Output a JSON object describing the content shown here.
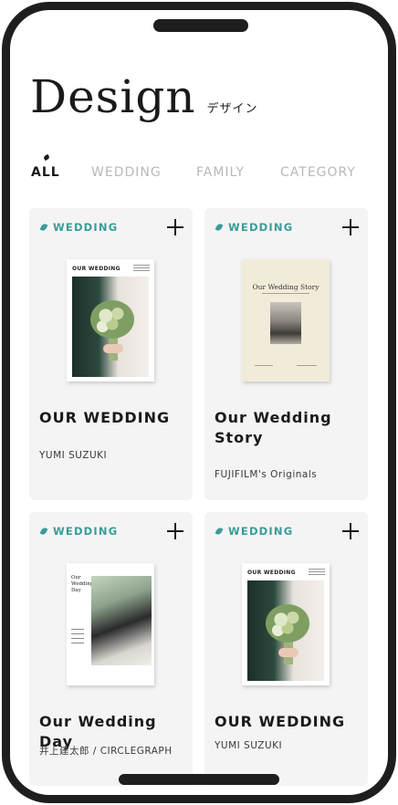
{
  "page": {
    "title_main": "Design",
    "title_sub": "デザイン"
  },
  "tabs": [
    {
      "label": "ALL",
      "active": true
    },
    {
      "label": "WEDDING",
      "active": false
    },
    {
      "label": "FAMILY",
      "active": false
    },
    {
      "label": "CATEGORY",
      "active": false
    }
  ],
  "cards": [
    {
      "tag": "WEDDING",
      "title": "OUR WEDDING",
      "author": "YUMI SUZUKI",
      "cover_text": "OUR WEDDING"
    },
    {
      "tag": "WEDDING",
      "title": "Our Wedding Story",
      "author": "FUJIFILM's Originals",
      "cover_text": "Our Wedding Story"
    },
    {
      "tag": "WEDDING",
      "title": "Our Wedding Day",
      "author": "井上建太郎 / CIRCLEGRAPH",
      "cover_text": "Our Wedding Day"
    },
    {
      "tag": "WEDDING",
      "title": "OUR WEDDING",
      "author": "YUMI SUZUKI",
      "cover_text": "OUR WEDDING"
    }
  ],
  "colors": {
    "accent": "#3a9c9a",
    "card_bg": "#f4f4f4",
    "frame": "#1e1e1e",
    "tab_inactive": "#b9b9b9"
  },
  "icons": {
    "add": "plus-icon",
    "tag": "leaf-icon"
  }
}
